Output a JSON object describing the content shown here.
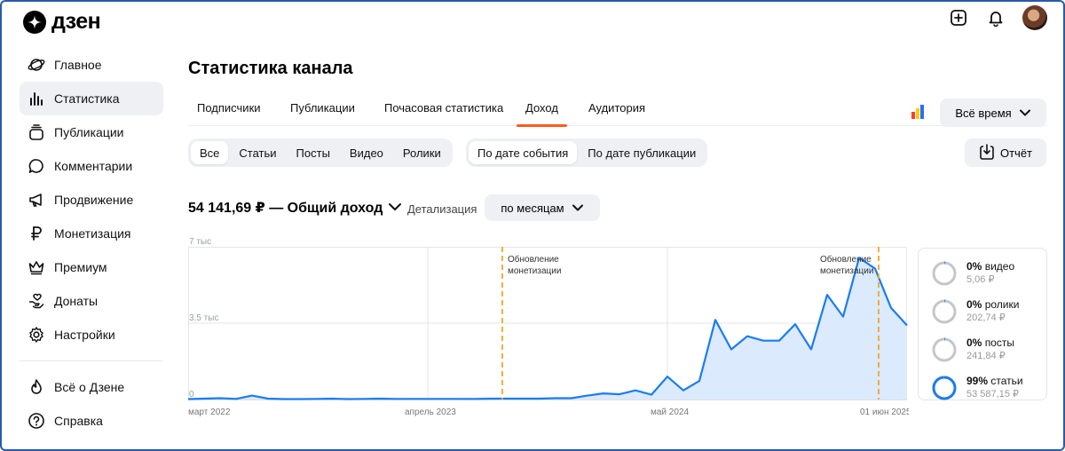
{
  "header": {
    "logo_text": "дзен",
    "icons": [
      "plus-square-icon",
      "bell-icon",
      "avatar"
    ]
  },
  "sidebar": {
    "items": [
      {
        "label": "Главное",
        "icon": "planet-icon"
      },
      {
        "label": "Статистика",
        "icon": "bar-chart-icon",
        "active": true
      },
      {
        "label": "Публикации",
        "icon": "stack-icon"
      },
      {
        "label": "Комментарии",
        "icon": "comment-icon"
      },
      {
        "label": "Продвижение",
        "icon": "megaphone-icon"
      },
      {
        "label": "Монетизация",
        "icon": "ruble-icon"
      },
      {
        "label": "Премиум",
        "icon": "crown-icon"
      },
      {
        "label": "Донаты",
        "icon": "donate-icon"
      },
      {
        "label": "Настройки",
        "icon": "gear-icon"
      }
    ],
    "secondary": [
      {
        "label": "Всё о Дзене",
        "icon": "flame-icon"
      },
      {
        "label": "Справка",
        "icon": "help-icon"
      }
    ]
  },
  "main": {
    "title": "Статистика канала",
    "tabs": [
      {
        "label": "Подписчики"
      },
      {
        "label": "Публикации"
      },
      {
        "label": "Почасовая статистика"
      },
      {
        "label": "Доход",
        "active": true
      },
      {
        "label": "Аудитория"
      }
    ],
    "period": "Всё время",
    "content_filter": [
      "Все",
      "Статьи",
      "Посты",
      "Видео",
      "Ролики"
    ],
    "date_filter": [
      "По дате события",
      "По дате публикации"
    ],
    "report_label": "Отчёт",
    "total_label": "54 141,69 ₽ — Общий доход",
    "detail_label": "Детализация",
    "detail_value": "по месяцам"
  },
  "colors": {
    "accent": "#ff5a1f",
    "line": "#1a7df0",
    "area": "#dbeafd",
    "marker": "#f5a623",
    "brand_bars": [
      "#ff3b30",
      "#ffcc00",
      "#2a6df4"
    ]
  },
  "chart_data": {
    "type": "area",
    "y_ticks": [
      "7 тыс",
      "3.5 тыс",
      "0"
    ],
    "ylim": [
      0,
      7000
    ],
    "x_ticks": [
      "март 2022",
      "апрель 2023",
      "май 2024",
      "01 июн 2025"
    ],
    "annotations": [
      "Обновление монетизации",
      "Обновление монетизации"
    ],
    "series": [
      {
        "values": [
          20,
          40,
          60,
          30,
          180,
          40,
          20,
          20,
          30,
          40,
          20,
          30,
          40,
          30,
          30,
          30,
          30,
          30,
          30,
          40,
          40,
          40,
          40,
          60,
          60,
          180,
          280,
          240,
          420,
          220,
          1050,
          420,
          850,
          3650,
          2300,
          2900,
          2700,
          2700,
          3450,
          2300,
          4800,
          3800,
          6500,
          6000,
          4200,
          3400
        ]
      }
    ]
  },
  "breakdown": [
    {
      "pct": "0%",
      "name": "видео",
      "value": "5,06 ₽",
      "fraction": 0.0
    },
    {
      "pct": "0%",
      "name": "ролики",
      "value": "202,74 ₽",
      "fraction": 0.004
    },
    {
      "pct": "0%",
      "name": "посты",
      "value": "241,84 ₽",
      "fraction": 0.004
    },
    {
      "pct": "99%",
      "name": "статьи",
      "value": "53 587,15 ₽",
      "fraction": 0.99
    }
  ]
}
